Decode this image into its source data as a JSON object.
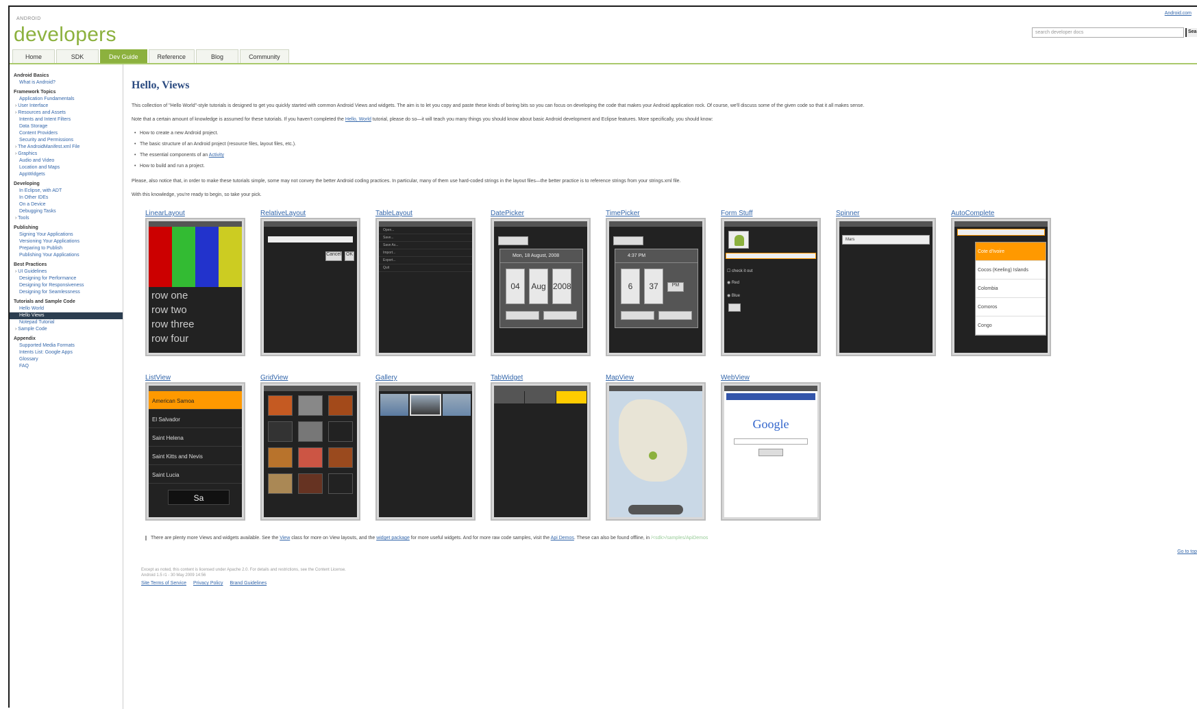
{
  "header": {
    "brand_small": "ANDROID",
    "brand": "developers",
    "top_link": "Android.com",
    "search_placeholder": "search developer docs",
    "search_button": "Search"
  },
  "tabs": [
    "Home",
    "SDK",
    "Dev Guide",
    "Reference",
    "Blog",
    "Community"
  ],
  "active_tab": "Dev Guide",
  "sidebar": [
    {
      "type": "head",
      "label": "Android Basics"
    },
    {
      "type": "item",
      "label": "What is Android?"
    },
    {
      "type": "head",
      "label": "Framework Topics"
    },
    {
      "type": "item",
      "label": "Application Fundamentals"
    },
    {
      "type": "exp",
      "label": "User Interface"
    },
    {
      "type": "exp",
      "label": "Resources and Assets"
    },
    {
      "type": "item",
      "label": "Intents and Intent Filters"
    },
    {
      "type": "item",
      "label": "Data Storage"
    },
    {
      "type": "item",
      "label": "Content Providers"
    },
    {
      "type": "item",
      "label": "Security and Permissions"
    },
    {
      "type": "exp",
      "label": "The AndroidManifest.xml File"
    },
    {
      "type": "exp",
      "label": "Graphics"
    },
    {
      "type": "item",
      "label": "Audio and Video"
    },
    {
      "type": "item",
      "label": "Location and Maps"
    },
    {
      "type": "item",
      "label": "AppWidgets"
    },
    {
      "type": "head",
      "label": "Developing"
    },
    {
      "type": "item",
      "label": "In Eclipse, with ADT"
    },
    {
      "type": "item",
      "label": "In Other IDEs"
    },
    {
      "type": "item",
      "label": "On a Device"
    },
    {
      "type": "item",
      "label": "Debugging Tasks"
    },
    {
      "type": "exp",
      "label": "Tools"
    },
    {
      "type": "head",
      "label": "Publishing"
    },
    {
      "type": "item",
      "label": "Signing Your Applications"
    },
    {
      "type": "item",
      "label": "Versioning Your Applications"
    },
    {
      "type": "item",
      "label": "Preparing to Publish"
    },
    {
      "type": "item",
      "label": "Publishing Your Applications"
    },
    {
      "type": "head",
      "label": "Best Practices"
    },
    {
      "type": "exp",
      "label": "UI Guidelines"
    },
    {
      "type": "item",
      "label": "Designing for Performance"
    },
    {
      "type": "item",
      "label": "Designing for Responsiveness"
    },
    {
      "type": "item",
      "label": "Designing for Seamlessness"
    },
    {
      "type": "head",
      "label": "Tutorials and Sample Code"
    },
    {
      "type": "item",
      "label": "Hello World"
    },
    {
      "type": "sel",
      "label": "Hello Views"
    },
    {
      "type": "item",
      "label": "Notepad Tutorial"
    },
    {
      "type": "exp",
      "label": "Sample Code"
    },
    {
      "type": "head",
      "label": "Appendix"
    },
    {
      "type": "item",
      "label": "Supported Media Formats"
    },
    {
      "type": "item",
      "label": "Intents List: Google Apps"
    },
    {
      "type": "item",
      "label": "Glossary"
    },
    {
      "type": "item",
      "label": "FAQ"
    }
  ],
  "main": {
    "title": "Hello, Views",
    "intro": "This collection of \"Hello World\"-style tutorials is designed to get you quickly started with common Android Views and widgets. The aim is to let you copy and paste these kinds of boring bits so you can focus on developing the code that makes your Android application rock. Of course, we'll discuss some of the given code so that it all makes sense.",
    "prereq_pre": "Note that a certain amount of knowledge is assumed for these tutorials. If you haven't completed the ",
    "prereq_link": "Hello, World",
    "prereq_post": " tutorial, please do so—it will teach you many things you should know about basic Android development and Eclipse features. More specifically, you should know:",
    "bullets": [
      "How to create a new Android project.",
      "The basic structure of an Android project (resource files, layout files, etc.).",
      "The essential components of an ",
      "How to build and run a project."
    ],
    "bullet_link": "Activity",
    "notice": "Please, also notice that, in order to make these tutorials simple, some may not convey the better Android coding practices. In particular, many of them use hard-coded strings in the layout files—the better practice is to reference strings from your strings.xml file.",
    "ready": "With this knowledge, you're ready to begin, so take your pick.",
    "note_pre": "There are plenty more Views and widgets available. See the ",
    "note_link1": "View",
    "note_mid1": " class for more on View layouts, and the ",
    "note_link2": "widget package",
    "note_mid2": " for more useful widgets. And for more raw code samples, visit the ",
    "note_link3": "Api Demos",
    "note_post": ". These can also be found offline, in",
    "note_path": " /<sdk>/samples/ApiDemos",
    "goto_top": "Go to top",
    "footer_copy": "Except as noted, this content is licensed under Apache 2.0. For details and restrictions, see the Content License.",
    "footer_build": "Android 1.5 r1 - 30 May 2009 14:56",
    "footer_links": [
      "Site Terms of Service",
      "Privacy Policy",
      "Brand Guidelines"
    ]
  },
  "tiles_row1": [
    "LinearLayout",
    "RelativeLayout",
    "TableLayout",
    "DatePicker",
    "TimePicker",
    "Form Stuff",
    "Spinner",
    "AutoComplete"
  ],
  "tiles_row2": [
    "ListView",
    "GridView",
    "Gallery",
    "TabWidget",
    "MapView",
    "WebView"
  ],
  "shots": {
    "linear_rows": [
      "row one",
      "row two",
      "row three",
      "row four"
    ],
    "linear_colors": [
      "#cc0000",
      "#33bb33",
      "#2233cc",
      "#cccc22"
    ],
    "date": {
      "header": "Mon, 18 August, 2008",
      "day": "04",
      "month": "Aug",
      "year": "2008"
    },
    "time": {
      "header": "4:37 PM",
      "hour": "6",
      "minute": "37",
      "ampm": "PM"
    },
    "autocomplete": [
      "Cote d'Ivoire",
      "Cocos (Keeling) Islands",
      "Colombia",
      "Comoros",
      "Congo"
    ],
    "listview": [
      "American Samoa",
      "El Salvador",
      "Saint Helena",
      "Saint Kitts and Nevis",
      "Saint Lucia"
    ],
    "listview_overlay": "Sa",
    "google": "Google",
    "table_rows": [
      "Open...",
      "Save...",
      "Save As...",
      "Import...",
      "Export...",
      "Quit"
    ],
    "form": {
      "checkbox": "check it out",
      "radio1": "Red",
      "radio2": "Blue"
    },
    "spinner_value": "Mars",
    "accent": "#ff9900",
    "brand_green": "#8cb13e"
  }
}
